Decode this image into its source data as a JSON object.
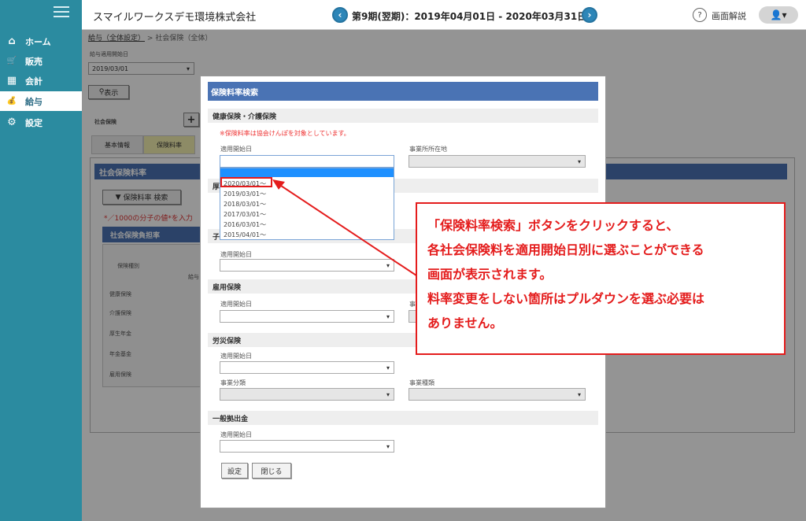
{
  "sidebar": {
    "items": [
      {
        "label": "ホーム",
        "icon": "home-icon",
        "glyph": "⌂"
      },
      {
        "label": "販売",
        "icon": "cart-icon",
        "glyph": "🛒"
      },
      {
        "label": "会計",
        "icon": "calculator-icon",
        "glyph": "▦"
      },
      {
        "label": "給与",
        "icon": "money-bag-icon",
        "glyph": "💰"
      },
      {
        "label": "設定",
        "icon": "gear-icon",
        "glyph": "⚙"
      }
    ]
  },
  "header": {
    "company": "スマイルワークスデモ環境株式会社",
    "period": "第9期(翌期)：2019年04月01日 - 2020年03月31日",
    "help": "画面解説",
    "prev": "‹",
    "next": "›",
    "help_icon": "?",
    "user_glyph": "👤▾"
  },
  "breadcrumb": {
    "link": "給与（全体設定）",
    "separator": ">",
    "current": "社会保険（全体）"
  },
  "page": {
    "date_label": "給与適用開始日",
    "date_value": "2019/03/01",
    "show_button": "表示",
    "show_icon": "⚲",
    "insurance_label": "社会保険",
    "add_button": "+",
    "tabs": [
      "基本情報",
      "保険料率"
    ],
    "panel_title": "社会保険料率",
    "search_button": "保険料率 検索",
    "search_icon": "▼",
    "note": "*／1000の分子の値*を入力",
    "subpanel": "社会保険負担率",
    "col_type": "保険種別",
    "col_salary": "給与",
    "rows": [
      "健康保険",
      "介護保険",
      "厚生年金",
      "年金基金",
      "雇用保険"
    ]
  },
  "modal": {
    "title": "保険料率検索",
    "health_section": "健康保険・介護保険",
    "health_note": "※保険料率は協会けんぽを対象としています。",
    "start_label": "適用開始日",
    "location_label": "事業所所在地",
    "hidden_section_a": "厚",
    "hidden_section_b": "子",
    "start_label_2": "適用開始日",
    "employment_section": "雇用保険",
    "start_label_3": "適用開始日",
    "emp_right_label": "事",
    "accident_section": "労災保険",
    "start_label_4": "適用開始日",
    "business_category": "事業分類",
    "business_type": "事業種類",
    "contribution_section": "一般拠出金",
    "start_label_5": "適用開始日",
    "set_button": "設定",
    "close_button": "閉じる"
  },
  "dropdown": {
    "options": [
      "2020/03/01～",
      "2019/03/01～",
      "2018/03/01～",
      "2017/03/01～",
      "2016/03/01～",
      "2015/04/01～"
    ]
  },
  "callout": {
    "lines": [
      "「保険料率検索」ボタンをクリックすると、",
      "各社会保険料を適用開始日別に選ぶことができる",
      "画面が表示されます。",
      "料率変更をしない箇所はプルダウンを選ぶ必要は",
      "ありません。"
    ]
  },
  "colors": {
    "sidebar": "#2b8ba0",
    "modal_header": "#4a73b4",
    "callout": "#e41c1c",
    "highlight_tab": "#f3efb0"
  }
}
